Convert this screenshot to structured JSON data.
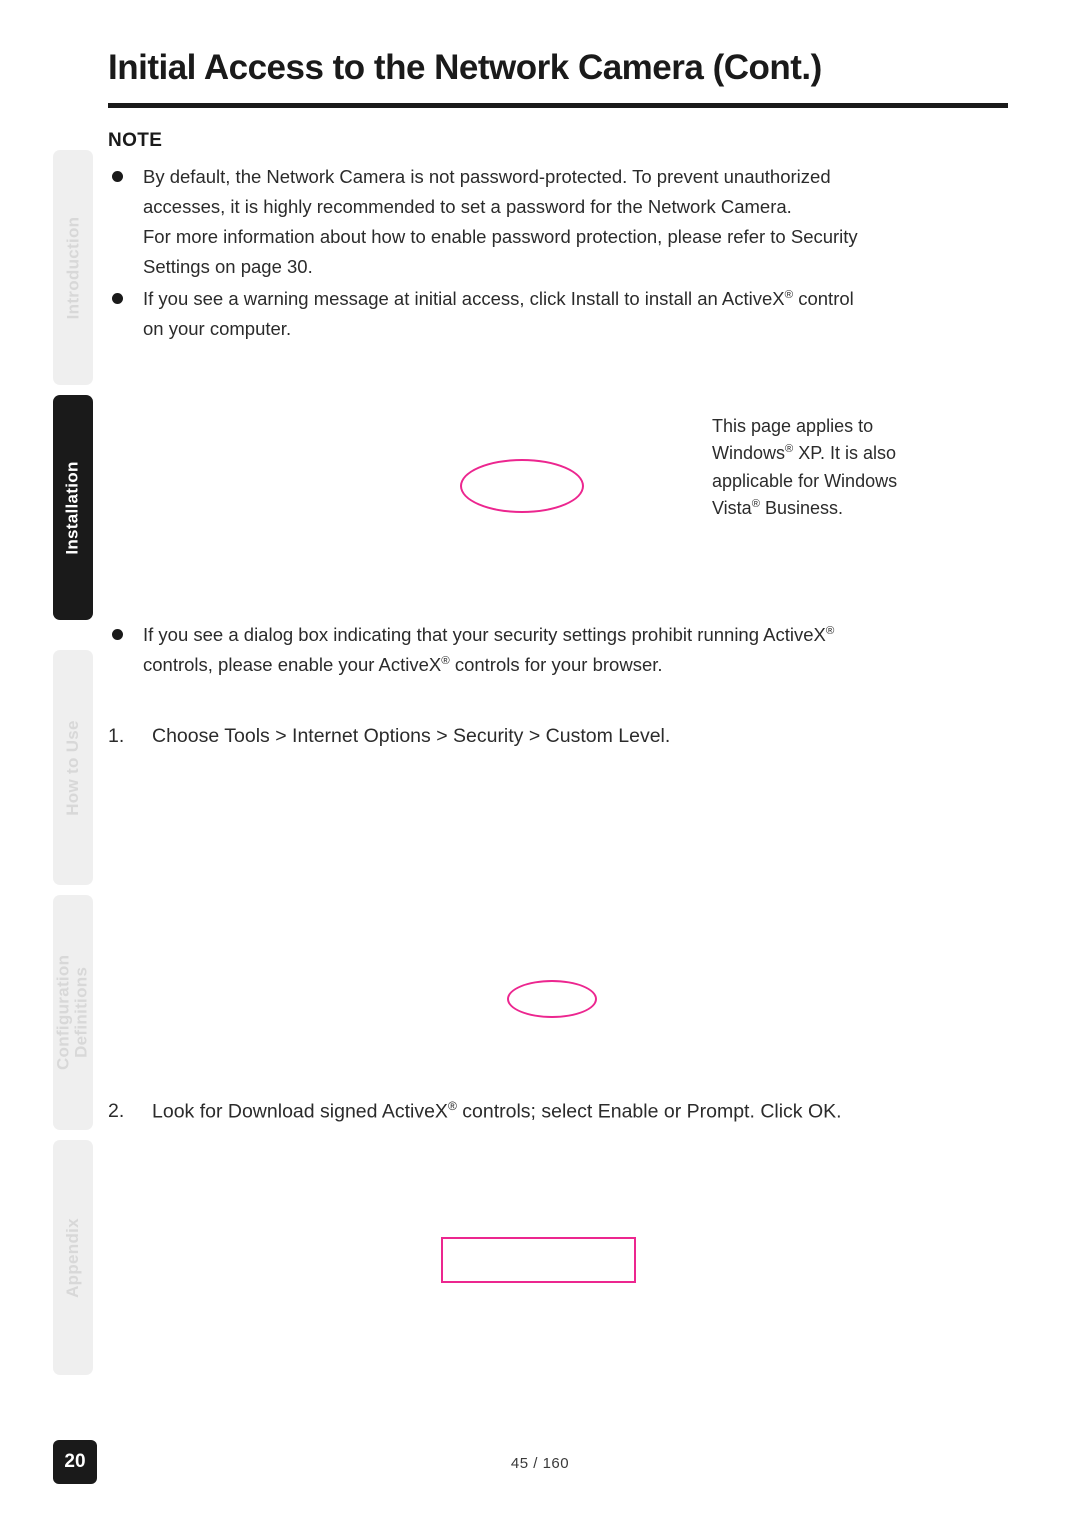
{
  "document": {
    "title": "Initial Access to the Network Camera (Cont.)",
    "page_number": "20",
    "footer": "45 / 160"
  },
  "side_tabs": [
    {
      "label": "Introduction",
      "active": false
    },
    {
      "label": "Installation",
      "active": true
    },
    {
      "label": "How to Use",
      "active": false
    },
    {
      "label": "Configuration",
      "label2": "Definitions",
      "active": false
    },
    {
      "label": "Appendix",
      "active": false
    }
  ],
  "note": {
    "heading": "NOTE",
    "bullets": [
      {
        "line1": "By default, the Network Camera is not password-protected. To prevent unauthorized",
        "line2": "accesses, it is highly recommended to set a password for the Network Camera.",
        "line3": "For more information about how to enable password protection, please refer to Security",
        "line4": "Settings on page 30."
      },
      {
        "line1_pre": "If you see a warning message at initial access, click Install to install an ActiveX",
        "line1_post": " control",
        "line2": "on your computer."
      }
    ]
  },
  "side_note": {
    "line1": "This page applies to",
    "line2_pre": "Windows",
    "line2_post": " XP. It is also",
    "line3": "applicable for Windows",
    "line4_pre": "Vista",
    "line4_post": " Business."
  },
  "activex_bullet": {
    "line1_pre": "If you see a dialog box indicating that your security settings prohibit running ActiveX",
    "line2_pre": "controls, please enable your ActiveX",
    "line2_post": " controls for your browser."
  },
  "steps": [
    {
      "number": "1.",
      "text": "Choose Tools > Internet Options > Security > Custom Level."
    },
    {
      "number": "2.",
      "text_pre": "Look for Download signed ActiveX",
      "text_post": " controls; select Enable or Prompt. Click OK."
    }
  ],
  "annotations": {
    "color": "#ec268f",
    "shapes": [
      "ellipse",
      "ellipse",
      "rectangle"
    ]
  },
  "symbols": {
    "registered": "®",
    "bullet": "●"
  }
}
